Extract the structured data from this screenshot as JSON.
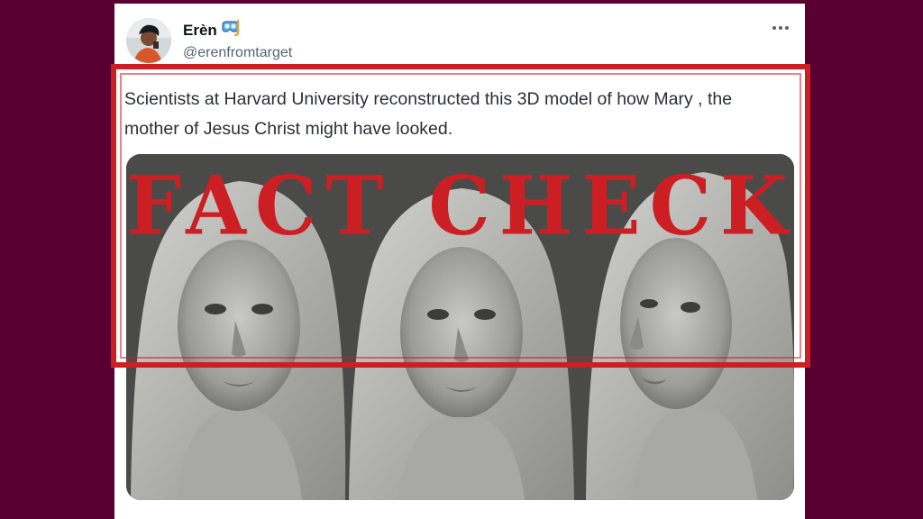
{
  "tweet": {
    "display_name": "Erèn",
    "handle": "@erenfromtarget",
    "text": "Scientists at Harvard University reconstructed this 3D model of how Mary , the mother of Jesus Christ might have looked."
  },
  "stamp": {
    "text": "FACT CHECK",
    "color": "#cc1f24"
  },
  "colors": {
    "page_background": "#5a0030",
    "card_background": "#ffffff",
    "secondary_text": "#536471"
  },
  "icons": {
    "badge": "diving-mask-icon",
    "more": "more-options-icon"
  }
}
